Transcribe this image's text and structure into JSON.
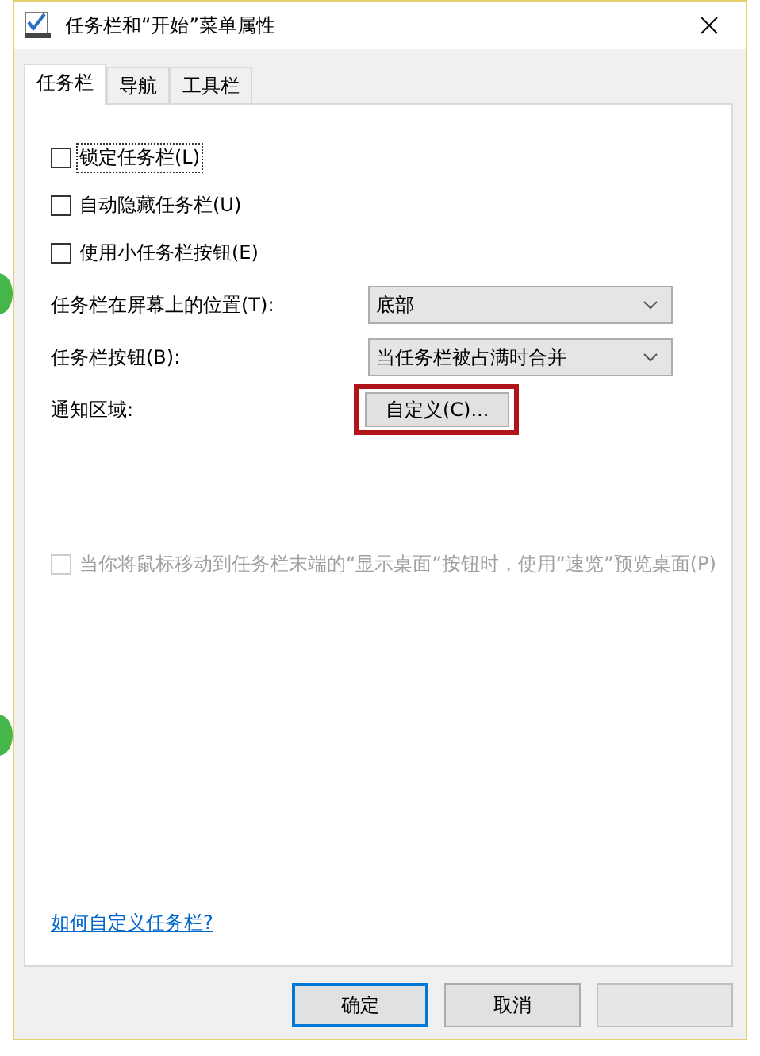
{
  "window": {
    "title": "任务栏和“开始”菜单属性"
  },
  "tabs": [
    {
      "label": "任务栏",
      "selected": true
    },
    {
      "label": "导航",
      "selected": false
    },
    {
      "label": "工具栏",
      "selected": false
    }
  ],
  "checkboxes": [
    {
      "label": "锁定任务栏(L)",
      "checked": false,
      "focused": true
    },
    {
      "label": "自动隐藏任务栏(U)",
      "checked": false,
      "focused": false
    },
    {
      "label": "使用小任务栏按钮(E)",
      "checked": false,
      "focused": false
    }
  ],
  "settings": [
    {
      "kind": "dropdown",
      "label": "任务栏在屏幕上的位置(T):",
      "value": "底部"
    },
    {
      "kind": "dropdown",
      "label": "任务栏按钮(B):",
      "value": "当任务栏被占满时合并"
    },
    {
      "kind": "button",
      "label": "通知区域:",
      "value": "自定义(C)...",
      "highlighted": true
    }
  ],
  "peek_option": {
    "label": "当你将鼠标移动到任务栏末端的“显示桌面”按钮时，使用“速览”预览桌面(P)",
    "checked": false,
    "disabled": true
  },
  "help_link": "如何自定义任务栏?",
  "buttons": [
    {
      "label": "确定",
      "default": true,
      "disabled": false
    },
    {
      "label": "取消",
      "default": false,
      "disabled": false
    },
    {
      "default": false,
      "disabled": true
    }
  ]
}
